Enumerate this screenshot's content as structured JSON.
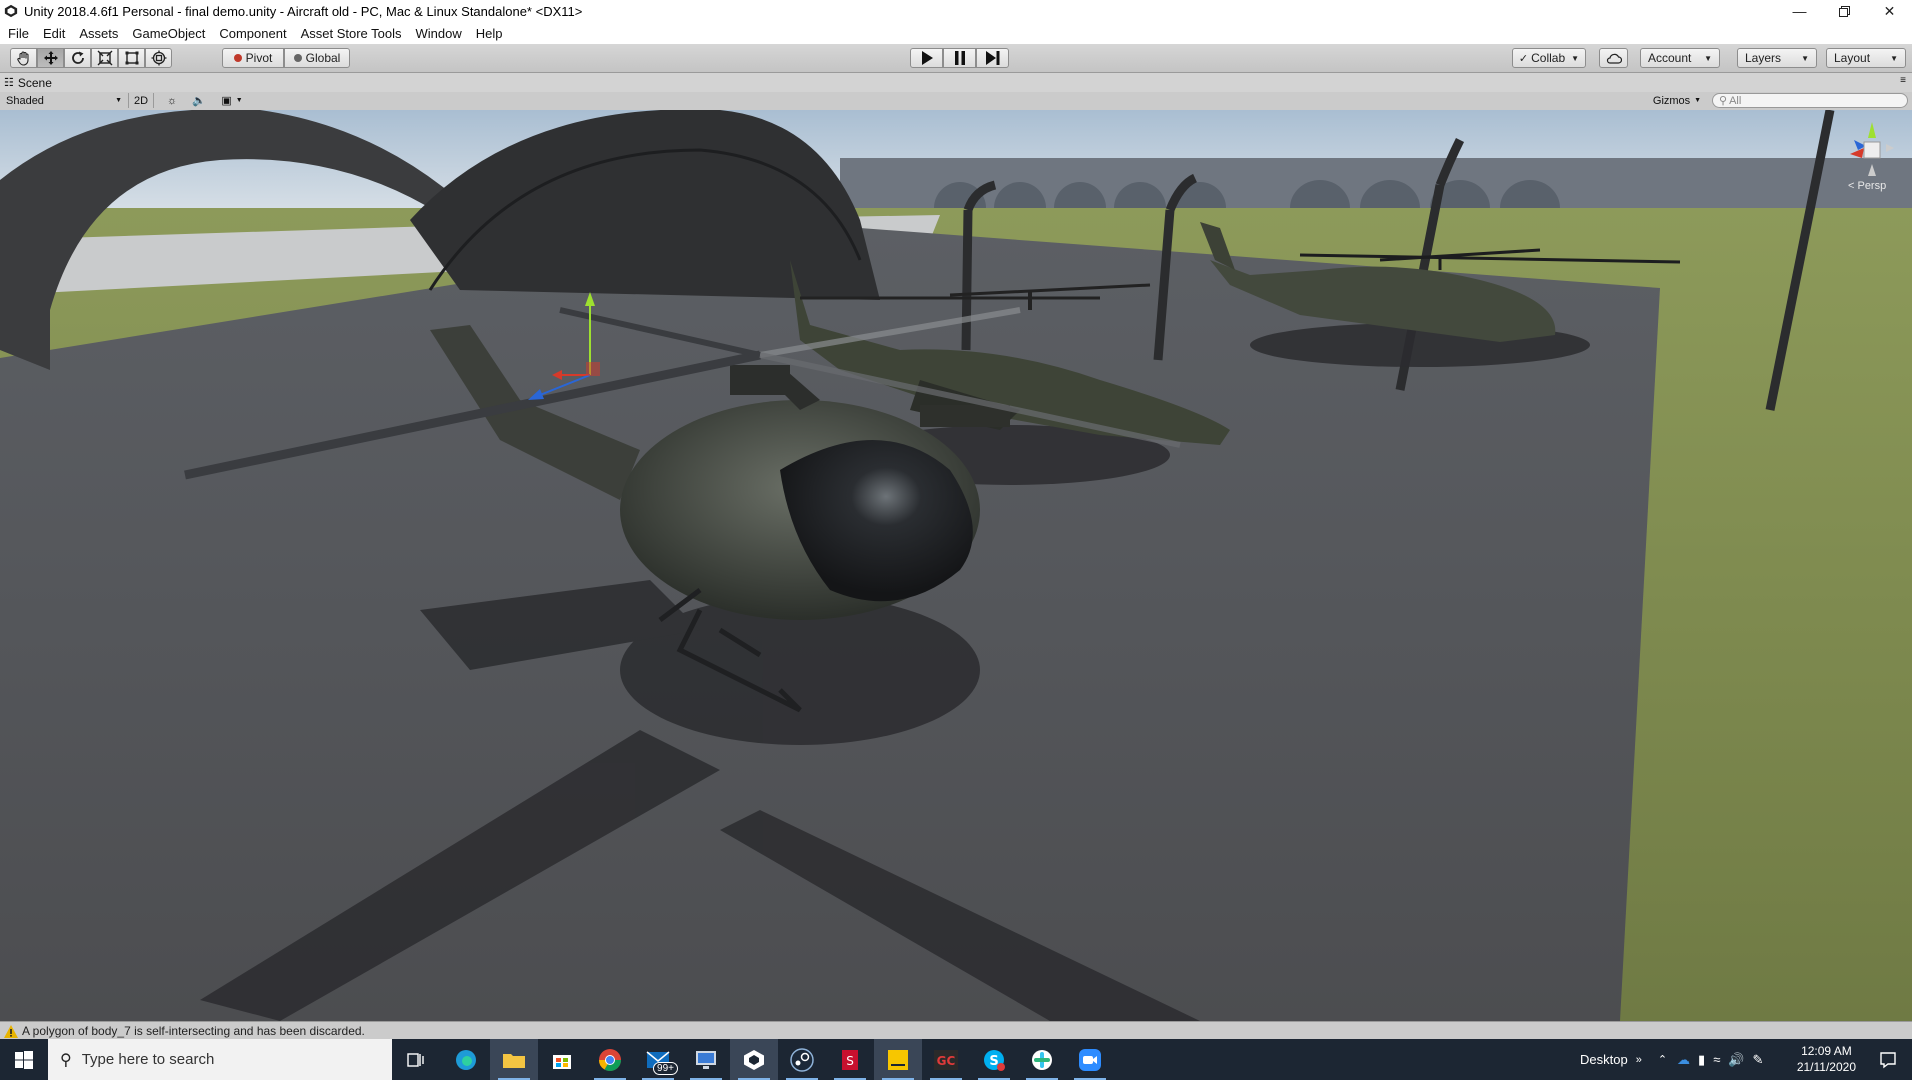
{
  "window": {
    "title": "Unity 2018.4.6f1 Personal - final demo.unity - Aircraft old - PC, Mac & Linux Standalone* <DX11>",
    "icon": "unity-icon",
    "controls": [
      "minimize-icon",
      "restore-icon",
      "close-icon"
    ]
  },
  "menu": [
    "File",
    "Edit",
    "Assets",
    "GameObject",
    "Component",
    "Asset Store Tools",
    "Window",
    "Help"
  ],
  "toolbar": {
    "tools": [
      {
        "name": "hand-tool",
        "icon": "hand-icon",
        "active": false
      },
      {
        "name": "move-tool",
        "icon": "move-arrows-icon",
        "active": true
      },
      {
        "name": "rotate-tool",
        "icon": "rotate-icon",
        "active": false
      },
      {
        "name": "scale-tool",
        "icon": "scale-icon",
        "active": false
      },
      {
        "name": "rect-tool",
        "icon": "rect-icon",
        "active": false
      },
      {
        "name": "transform-tool",
        "icon": "transform-icon",
        "active": false
      }
    ],
    "pivot_label": "Pivot",
    "global_label": "Global",
    "playback": [
      "play-icon",
      "pause-icon",
      "step-icon"
    ],
    "collab_label": "Collab",
    "account_label": "Account",
    "layers_label": "Layers",
    "layout_label": "Layout"
  },
  "scene": {
    "tab_label": "Scene",
    "shading_mode": "Shaded",
    "mode_2d": "2D",
    "gizmos_label": "Gizmos",
    "search_placeholder": "All",
    "persp_label": "< Persp"
  },
  "status": {
    "message": "A polygon of body_7 is self-intersecting and has been discarded.",
    "icon": "warning-icon"
  },
  "taskbar": {
    "search_placeholder": "Type here to search",
    "apps": [
      "task-view-icon",
      "edge-icon",
      "file-explorer-icon",
      "store-icon",
      "chrome-icon",
      "mail-icon",
      "remote-desktop-icon",
      "unity-icon",
      "steam-icon",
      "autodesk-icon",
      "sticky-notes-icon",
      "gc-icon",
      "skype-icon",
      "slack-icon",
      "zoom-icon"
    ],
    "mail_badge": "99+",
    "desktop_label": "Desktop",
    "time": "12:09 AM",
    "date": "21/11/2020"
  },
  "colors": {
    "toolbar_bg": "#c8c8c8",
    "taskbar_bg": "#1c2633",
    "warning": "#e8b400"
  }
}
